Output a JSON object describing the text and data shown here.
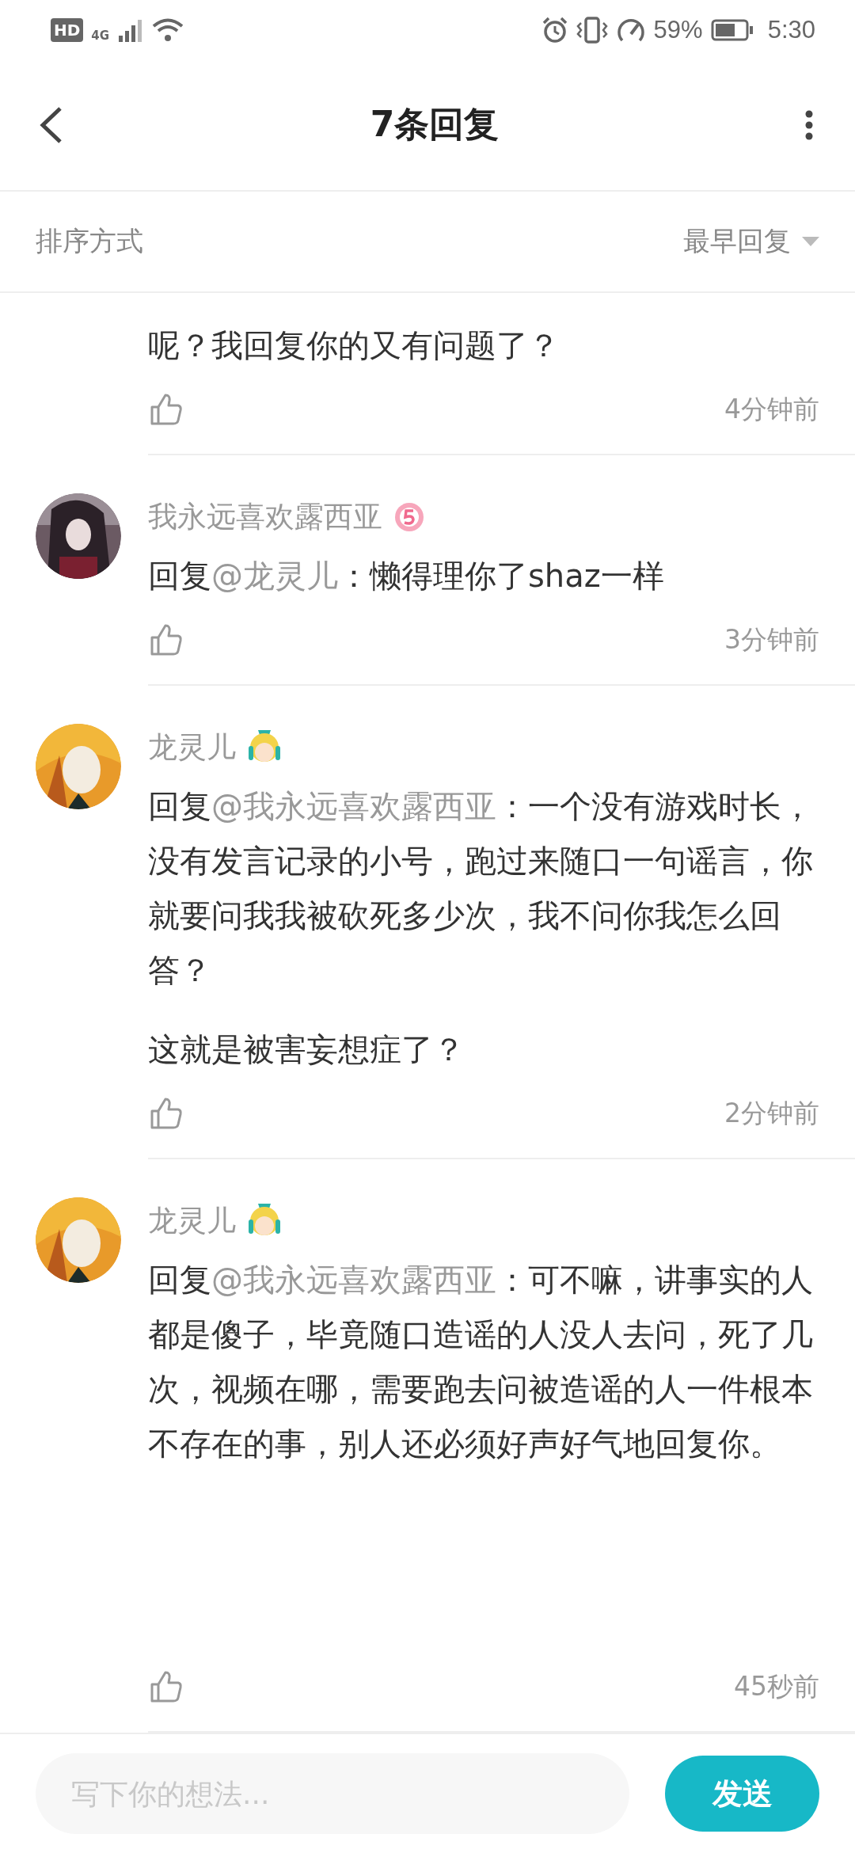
{
  "status_bar": {
    "hd": "HD",
    "network": "4G",
    "battery": "59%",
    "time": "5:30"
  },
  "header": {
    "title": "7条回复"
  },
  "sort": {
    "label": "排序方式",
    "value": "最早回复"
  },
  "replies": [
    {
      "paragraphs": [
        [
          {
            "text": "呢？我回复你的又有问题了？",
            "mention": false
          }
        ]
      ],
      "time": "4分钟前"
    },
    {
      "user": {
        "name": "我永远喜欢露西亚",
        "badge": {
          "kind": "level"
        }
      },
      "paragraphs": [
        [
          {
            "text": "回复",
            "mention": false
          },
          {
            "text": "@龙灵儿",
            "mention": true
          },
          {
            "text": "：懒得理你了shaz一样",
            "mention": false
          }
        ]
      ],
      "time": "3分钟前"
    },
    {
      "user": {
        "name": "龙灵儿",
        "badge": {
          "kind": "chibi"
        }
      },
      "paragraphs": [
        [
          {
            "text": "回复",
            "mention": false
          },
          {
            "text": "@我永远喜欢露西亚",
            "mention": true
          },
          {
            "text": "：一个没有游戏时长，没有发言记录的小号，跑过来随口一句谣言，你就要问我我被砍死多少次，我不问你我怎么回答？",
            "mention": false
          }
        ],
        [
          {
            "text": "这就是被害妄想症了？",
            "mention": false
          }
        ]
      ],
      "time": "2分钟前"
    },
    {
      "user": {
        "name": "龙灵儿",
        "badge": {
          "kind": "chibi"
        }
      },
      "paragraphs": [
        [
          {
            "text": "回复",
            "mention": false
          },
          {
            "text": "@我永远喜欢露西亚",
            "mention": true
          },
          {
            "text": "：可不嘛，讲事实的人都是傻子，毕竟随口造谣的人没人去问，死了几次，视频在哪，需要跑去问被造谣的人一件根本不存在的事，别人还必须好声好气地回复你。",
            "mention": false
          }
        ]
      ],
      "time": "45秒前"
    }
  ],
  "composer": {
    "placeholder": "写下你的想法...",
    "send": "发送"
  }
}
